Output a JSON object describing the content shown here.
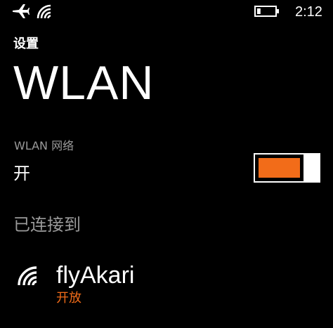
{
  "status_bar": {
    "airplane_icon": "airplane-icon",
    "wifi_icon": "wifi-signal-icon",
    "battery_icon": "battery-icon",
    "battery_level": 0.2,
    "time": "2:12"
  },
  "header": {
    "section": "设置",
    "title": "WLAN"
  },
  "wlan": {
    "label": "WLAN 网络",
    "state": "开",
    "toggle_on": true,
    "toggle_fill_fraction": 1.0
  },
  "connected": {
    "header": "已连接到",
    "network": {
      "icon": "wifi-signal-icon",
      "name": "flyAkari",
      "status": "开放"
    }
  },
  "colors": {
    "background": "#000000",
    "foreground": "#ffffff",
    "accent": "#f26c19",
    "secondary_text": "#9a9a9a"
  }
}
